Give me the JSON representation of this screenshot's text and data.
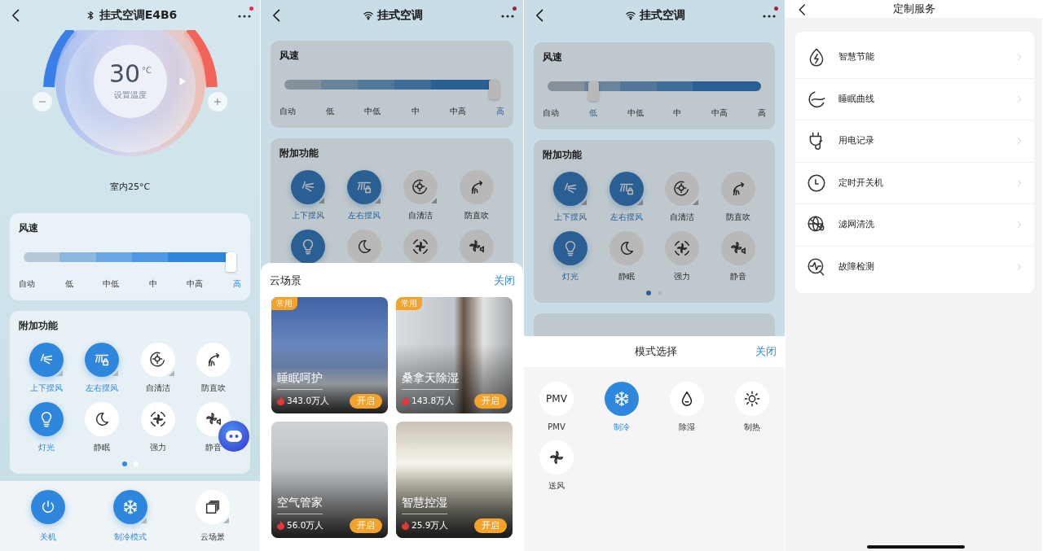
{
  "screens": [
    {
      "kind": "device",
      "title": "挂式空调E4B6",
      "notification": true,
      "thermostat": {
        "temperature": "30",
        "unit": "°C",
        "caption": "设置温度",
        "indoor": "室内25°C"
      },
      "fan_speed": {
        "title": "风速",
        "level": 1,
        "steps": [
          {
            "label": "自动",
            "selected": false
          },
          {
            "label": "低",
            "selected": false
          },
          {
            "label": "中低",
            "selected": false
          },
          {
            "label": "中",
            "selected": false
          },
          {
            "label": "中高",
            "selected": false
          },
          {
            "label": "高",
            "selected": true
          }
        ]
      },
      "extras": {
        "title": "附加功能",
        "items": [
          {
            "label": "上下摆风",
            "on": true,
            "expandable": true
          },
          {
            "label": "左右摆风",
            "on": true,
            "expandable": true
          },
          {
            "label": "自清洁",
            "on": false,
            "expandable": true
          },
          {
            "label": "防直吹",
            "on": false,
            "expandable": false
          },
          {
            "label": "灯光",
            "on": true,
            "expandable": false
          },
          {
            "label": "静眠",
            "on": false,
            "expandable": false
          },
          {
            "label": "强力",
            "on": false,
            "expandable": false
          },
          {
            "label": "静音",
            "on": false,
            "expandable": false
          }
        ],
        "pages": [
          {
            "selected": true
          },
          {
            "selected": false
          }
        ]
      },
      "assistant": true,
      "bottom_bar": [
        {
          "label": "关机",
          "on": true,
          "expandable": false
        },
        {
          "label": "制冷模式",
          "on": true,
          "expandable": true
        },
        {
          "label": "云场景",
          "on": false,
          "expandable": true
        }
      ]
    },
    {
      "kind": "scenes",
      "title": "挂式空调",
      "notification": true,
      "fan_speed": {
        "title": "风速",
        "level": 1,
        "steps": [
          {
            "label": "自动",
            "selected": false
          },
          {
            "label": "低",
            "selected": false
          },
          {
            "label": "中低",
            "selected": false
          },
          {
            "label": "中",
            "selected": false
          },
          {
            "label": "中高",
            "selected": false
          },
          {
            "label": "高",
            "selected": true
          }
        ]
      },
      "extras": {
        "title": "附加功能",
        "items": [
          {
            "label": "上下摆风",
            "on": true,
            "expandable": true
          },
          {
            "label": "左右摆风",
            "on": true,
            "expandable": true
          },
          {
            "label": "自清洁",
            "on": false,
            "expandable": true
          },
          {
            "label": "防直吹",
            "on": false,
            "expandable": false
          },
          {
            "on": true,
            "expandable": false
          },
          {
            "on": false,
            "expandable": false
          },
          {
            "on": false,
            "expandable": false
          },
          {
            "on": false,
            "expandable": false
          }
        ]
      },
      "sheet": {
        "title": "云场景",
        "close": "关闭",
        "cards": [
          {
            "tag": "常用",
            "name": "睡眠呵护",
            "count": "343.0万人",
            "action": "开启"
          },
          {
            "tag": "常用",
            "name": "桑拿天除湿",
            "count": "143.8万人",
            "action": "开启"
          },
          {
            "name": "空气管家",
            "count": "56.0万人",
            "action": "开启"
          },
          {
            "name": "智慧控湿",
            "count": "25.9万人",
            "action": "开启"
          }
        ]
      }
    },
    {
      "kind": "modes",
      "title": "挂式空调",
      "notification": true,
      "fan_speed": {
        "title": "风速",
        "level": 0.2,
        "steps": [
          {
            "label": "自动",
            "selected": false
          },
          {
            "label": "低",
            "selected": true
          },
          {
            "label": "中低",
            "selected": false
          },
          {
            "label": "中",
            "selected": false
          },
          {
            "label": "中高",
            "selected": false
          },
          {
            "label": "高",
            "selected": false
          }
        ]
      },
      "extras": {
        "title": "附加功能",
        "items": [
          {
            "label": "上下摆风",
            "on": true,
            "expandable": true
          },
          {
            "label": "左右摆风",
            "on": true,
            "expandable": true
          },
          {
            "label": "自清洁",
            "on": false,
            "expandable": true
          },
          {
            "label": "防直吹",
            "on": false,
            "expandable": false
          },
          {
            "label": "灯光",
            "on": true,
            "expandable": false
          },
          {
            "label": "静眠",
            "on": false,
            "expandable": false
          },
          {
            "label": "强力",
            "on": false,
            "expandable": false
          },
          {
            "label": "静音",
            "on": false,
            "expandable": false
          }
        ],
        "pages": [
          {
            "selected": true
          },
          {
            "selected": false
          }
        ]
      },
      "sheet": {
        "title": "模式选择",
        "close": "关闭",
        "modes": [
          {
            "label": "PMV",
            "icon_text": "PMV",
            "selected": false
          },
          {
            "label": "制冷",
            "selected": true
          },
          {
            "label": "除湿",
            "selected": false
          },
          {
            "label": "制热",
            "selected": false
          },
          {
            "label": "送风",
            "selected": false
          }
        ]
      }
    },
    {
      "kind": "services",
      "title": "定制服务",
      "items": [
        {
          "label": "智慧节能"
        },
        {
          "label": "睡眠曲线"
        },
        {
          "label": "用电记录"
        },
        {
          "label": "定时开关机"
        },
        {
          "label": "滤网清洗"
        },
        {
          "label": "故障检测"
        }
      ]
    }
  ]
}
